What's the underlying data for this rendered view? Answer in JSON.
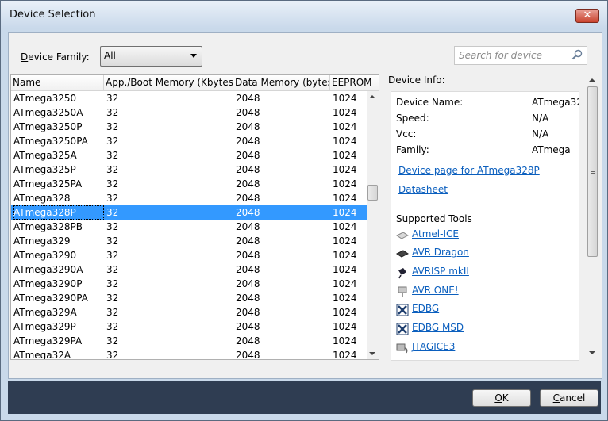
{
  "window": {
    "title": "Device Selection"
  },
  "filter": {
    "family_label": "Device Family:",
    "family_value": "All",
    "search_placeholder": "Search for device"
  },
  "grid": {
    "columns": [
      "Name",
      "App./Boot Memory (Kbytes)",
      "Data Memory (bytes)",
      "EEPROM"
    ],
    "rows": [
      [
        "ATmega3250",
        "32",
        "2048",
        "1024"
      ],
      [
        "ATmega3250A",
        "32",
        "2048",
        "1024"
      ],
      [
        "ATmega3250P",
        "32",
        "2048",
        "1024"
      ],
      [
        "ATmega3250PA",
        "32",
        "2048",
        "1024"
      ],
      [
        "ATmega325A",
        "32",
        "2048",
        "1024"
      ],
      [
        "ATmega325P",
        "32",
        "2048",
        "1024"
      ],
      [
        "ATmega325PA",
        "32",
        "2048",
        "1024"
      ],
      [
        "ATmega328",
        "32",
        "2048",
        "1024"
      ],
      [
        "ATmega328P",
        "32",
        "2048",
        "1024"
      ],
      [
        "ATmega328PB",
        "32",
        "2048",
        "1024"
      ],
      [
        "ATmega329",
        "32",
        "2048",
        "1024"
      ],
      [
        "ATmega3290",
        "32",
        "2048",
        "1024"
      ],
      [
        "ATmega3290A",
        "32",
        "2048",
        "1024"
      ],
      [
        "ATmega3290P",
        "32",
        "2048",
        "1024"
      ],
      [
        "ATmega3290PA",
        "32",
        "2048",
        "1024"
      ],
      [
        "ATmega329A",
        "32",
        "2048",
        "1024"
      ],
      [
        "ATmega329P",
        "32",
        "2048",
        "1024"
      ],
      [
        "ATmega329PA",
        "32",
        "2048",
        "1024"
      ],
      [
        "ATmega32A",
        "32",
        "2048",
        "1024"
      ]
    ],
    "selected": "ATmega328P"
  },
  "info": {
    "title": "Device Info:",
    "fields": [
      {
        "label": "Device Name:",
        "value": "ATmega32"
      },
      {
        "label": "Speed:",
        "value": "N/A"
      },
      {
        "label": "Vcc:",
        "value": "N/A"
      },
      {
        "label": "Family:",
        "value": "ATmega"
      }
    ],
    "device_page_link": "Device page for ATmega328P",
    "datasheet_link": "Datasheet",
    "tools_title": "Supported Tools",
    "tools": [
      {
        "label": "Atmel-ICE",
        "icon": "atmel-ice-icon"
      },
      {
        "label": "AVR Dragon",
        "icon": "avr-dragon-icon"
      },
      {
        "label": "AVRISP mkII",
        "icon": "avrisp-icon"
      },
      {
        "label": "AVR ONE!",
        "icon": "avr-one-icon"
      },
      {
        "label": "EDBG",
        "icon": "edbg-icon"
      },
      {
        "label": "EDBG MSD",
        "icon": "edbg-msd-icon"
      },
      {
        "label": "JTAGICE3",
        "icon": "jtagice3-icon"
      }
    ]
  },
  "buttons": {
    "ok": "OK",
    "cancel": "Cancel"
  },
  "colors": {
    "selection": "#3399ff",
    "link": "#0b5fbe",
    "footer": "#2f3d52"
  }
}
